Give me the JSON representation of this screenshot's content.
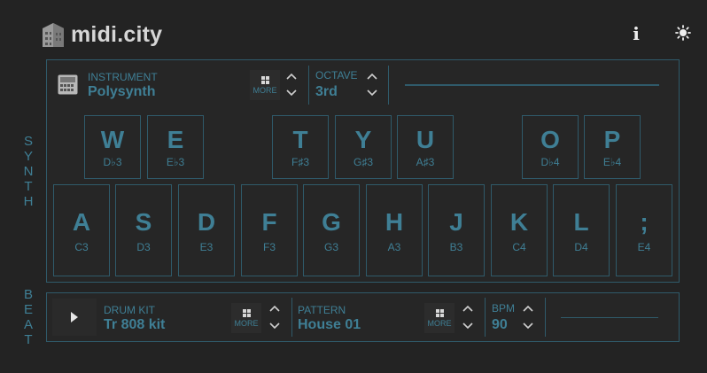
{
  "app": {
    "title": "midi.city"
  },
  "header": {
    "info_label": "i"
  },
  "side": {
    "synth_letters": [
      "S",
      "Y",
      "N",
      "T",
      "H"
    ],
    "beat_letters": [
      "B",
      "E",
      "A",
      "T"
    ]
  },
  "synth": {
    "instrument_label": "INSTRUMENT",
    "instrument_value": "Polysynth",
    "more_label": "MORE",
    "octave_label": "OCTAVE",
    "octave_value": "3rd",
    "black_keys": [
      {
        "letter": "W",
        "note": "D♭3"
      },
      {
        "letter": "E",
        "note": "E♭3"
      },
      {
        "letter": "T",
        "note": "F♯3"
      },
      {
        "letter": "Y",
        "note": "G♯3"
      },
      {
        "letter": "U",
        "note": "A♯3"
      },
      {
        "letter": "O",
        "note": "D♭4"
      },
      {
        "letter": "P",
        "note": "E♭4"
      }
    ],
    "white_keys": [
      {
        "letter": "A",
        "note": "C3"
      },
      {
        "letter": "S",
        "note": "D3"
      },
      {
        "letter": "D",
        "note": "E3"
      },
      {
        "letter": "F",
        "note": "F3"
      },
      {
        "letter": "G",
        "note": "G3"
      },
      {
        "letter": "H",
        "note": "A3"
      },
      {
        "letter": "J",
        "note": "B3"
      },
      {
        "letter": "K",
        "note": "C4"
      },
      {
        "letter": "L",
        "note": "D4"
      },
      {
        "letter": ";",
        "note": "E4"
      }
    ]
  },
  "beat": {
    "drumkit_label": "DRUM KIT",
    "drumkit_value": "Tr 808 kit",
    "more_label": "MORE",
    "pattern_label": "PATTERN",
    "pattern_value": "House 01",
    "bpm_label": "BPM",
    "bpm_value": "90"
  },
  "colors": {
    "accent": "#3f7f95",
    "border": "#2f5a6a",
    "background": "#232323"
  }
}
